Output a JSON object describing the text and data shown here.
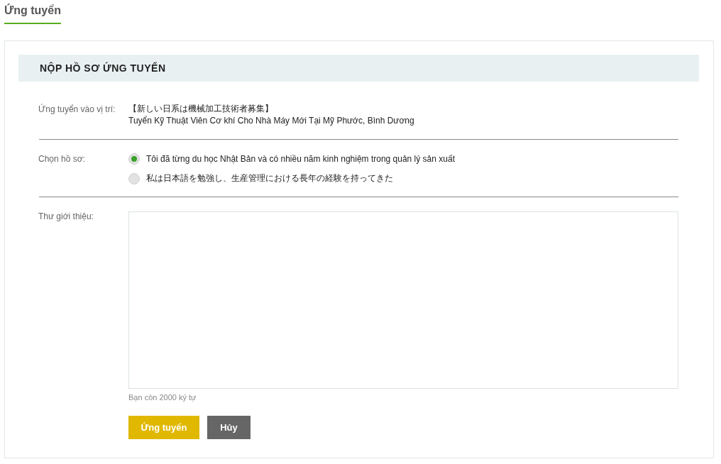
{
  "tab": {
    "label": "Ứng tuyển",
    "selected": true
  },
  "section_title": "NỘP HỒ SƠ ỨNG TUYỂN",
  "position": {
    "label": "Ứng tuyển vào vị trí:",
    "lines": [
      "【新しい日系は機械加工技術者募集】",
      "Tuyển Kỹ Thuật Viên Cơ khí Cho Nhà Máy Mới Tại Mỹ Phước, Bình Dương"
    ]
  },
  "profile": {
    "label": "Chọn hồ sơ:",
    "options": [
      {
        "label": "Tôi đã từng du học Nhật Bản và có nhiều năm kinh nghiệm trong quản lý sản xuất",
        "selected": true
      },
      {
        "label": "私は日本語を勉強し、生産管理における長年の経験を持ってきた",
        "selected": false
      }
    ]
  },
  "cover_letter": {
    "label": "Thư giới thiệu:",
    "counter": "Bạn còn 2000 ký tự"
  },
  "buttons": [
    {
      "label": "Ứng tuyển",
      "kind": "primary"
    },
    {
      "label": "Hủy",
      "kind": "secondary"
    }
  ]
}
